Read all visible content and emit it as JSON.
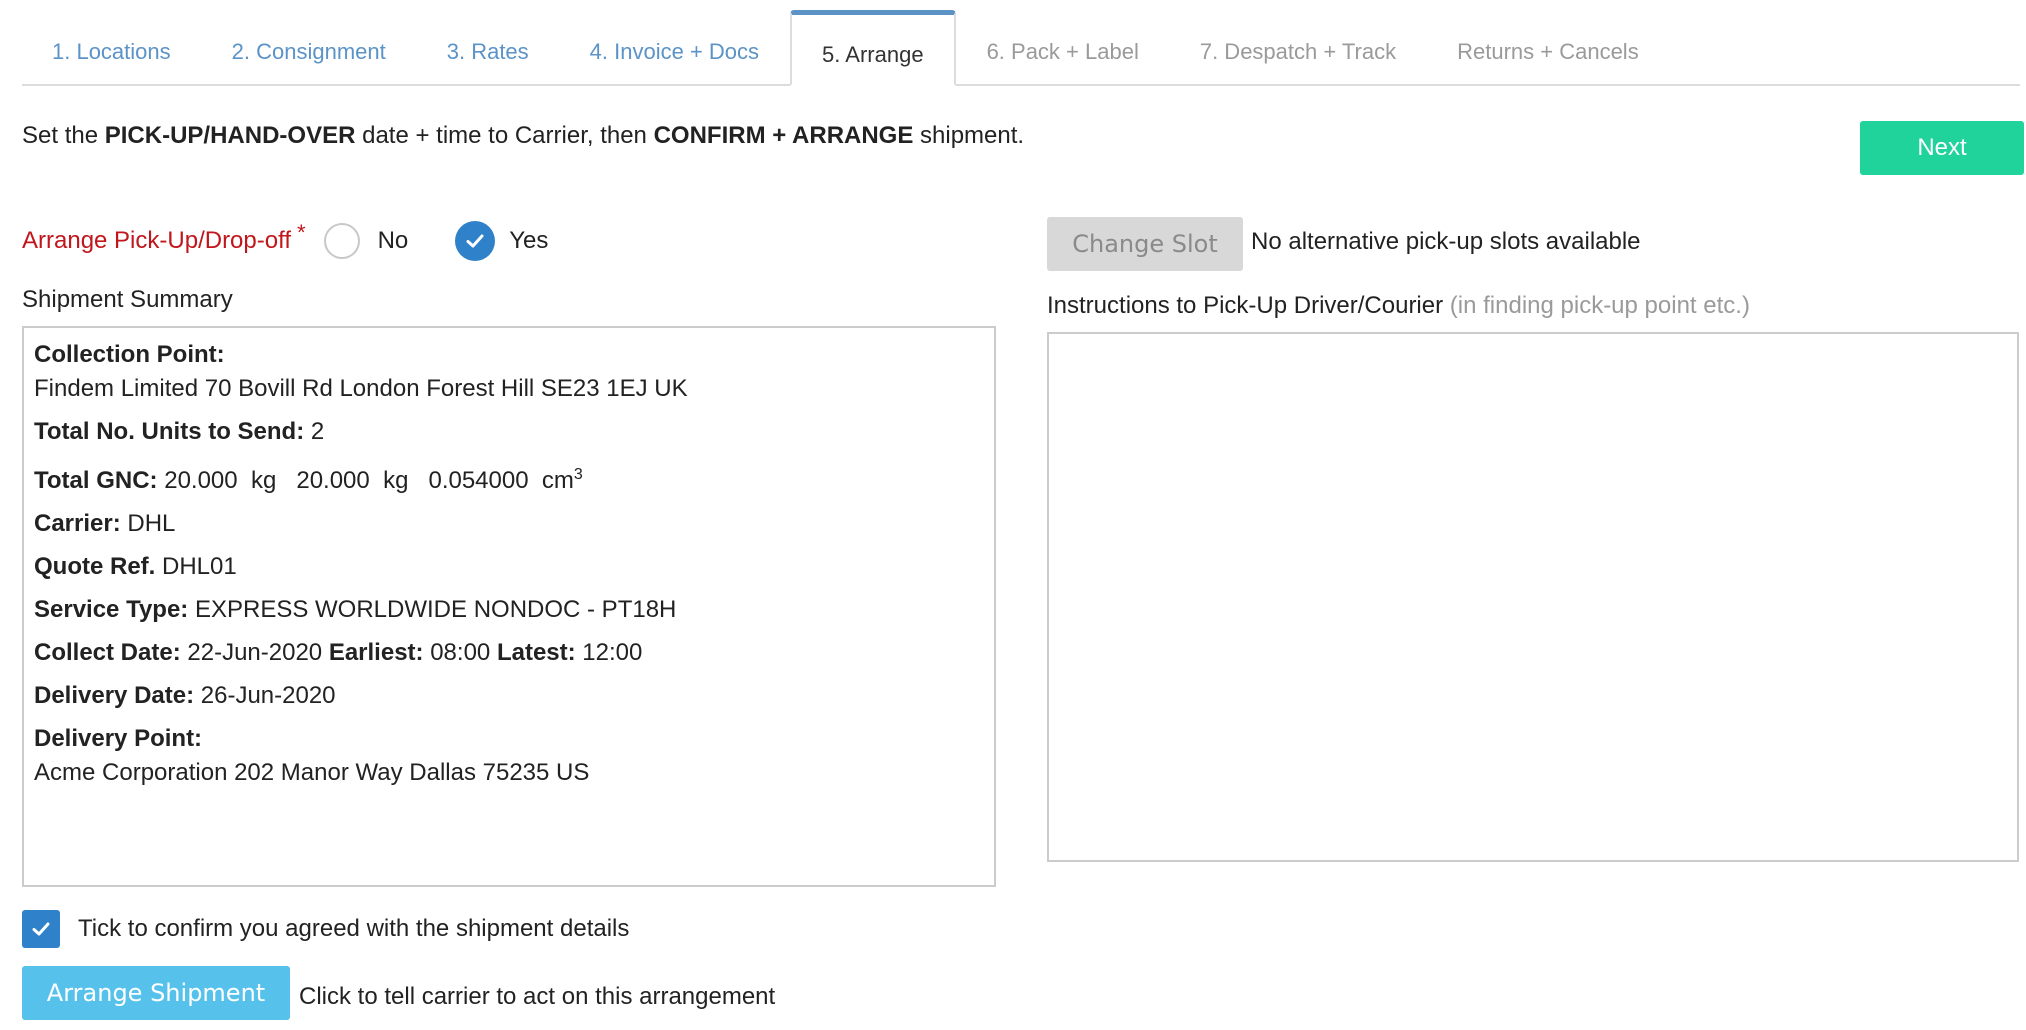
{
  "tabs": [
    {
      "label": "1. Locations",
      "state": "link"
    },
    {
      "label": "2. Consignment",
      "state": "link"
    },
    {
      "label": "3. Rates",
      "state": "link"
    },
    {
      "label": "4. Invoice + Docs",
      "state": "link"
    },
    {
      "label": "5. Arrange",
      "state": "active"
    },
    {
      "label": "6. Pack + Label",
      "state": "disabled"
    },
    {
      "label": "7. Despatch + Track",
      "state": "disabled"
    },
    {
      "label": "Returns + Cancels",
      "state": "disabled"
    }
  ],
  "intro": {
    "part1": "Set the ",
    "bold1": "PICK-UP/HAND-OVER",
    "part2": " date + time to Carrier, then ",
    "bold2": "CONFIRM + ARRANGE",
    "part3": " shipment."
  },
  "next_button": "Next",
  "arrange": {
    "label": "Arrange Pick-Up/Drop-off",
    "required_mark": "*",
    "option_no": "No",
    "option_yes": "Yes",
    "selected": "Yes"
  },
  "summary": {
    "title": "Shipment Summary",
    "collection_point_label": "Collection Point:",
    "collection_point": "Findem Limited 70 Bovill Rd London Forest Hill SE23 1EJ UK",
    "units_label": "Total No. Units to Send:",
    "units": "2",
    "gnc_label": "Total GNC:",
    "gnc_gross": "20.000",
    "gnc_net": "20.000",
    "gnc_volume": "0.054000",
    "weight_unit": "kg",
    "volume_unit": "cm",
    "volume_exp": "3",
    "carrier_label": "Carrier:",
    "carrier": "DHL",
    "quote_label": "Quote Ref.",
    "quote": "DHL01",
    "service_label": "Service Type:",
    "service": "EXPRESS WORLDWIDE NONDOC - PT18H",
    "collect_label": "Collect Date:",
    "collect_date": "22-Jun-2020",
    "earliest_label": "Earliest:",
    "earliest": "08:00",
    "latest_label": "Latest:",
    "latest": "12:00",
    "delivery_date_label": "Delivery Date:",
    "delivery_date": "26-Jun-2020",
    "delivery_point_label": "Delivery Point:",
    "delivery_point": "Acme Corporation 202 Manor Way Dallas 75235 US"
  },
  "slot": {
    "button": "Change Slot",
    "status": "No alternative pick-up slots available"
  },
  "instructions": {
    "label": "Instructions to Pick-Up Driver/Courier",
    "hint": "(in finding pick-up point etc.)",
    "value": ""
  },
  "confirm": {
    "checked": true,
    "label": "Tick to confirm you agreed with the shipment details"
  },
  "arrange_button": "Arrange Shipment",
  "arrange_hint": "Click to tell carrier to act on this arrangement",
  "colors": {
    "tab_link": "#5b93c7",
    "tab_disabled": "#9a9a9a",
    "required_label": "#c0161c",
    "next_button": "#1fd39a",
    "arrange_button": "#56c2ec",
    "check_blue": "#2f82c9",
    "disabled_button": "#d8d8d8"
  }
}
